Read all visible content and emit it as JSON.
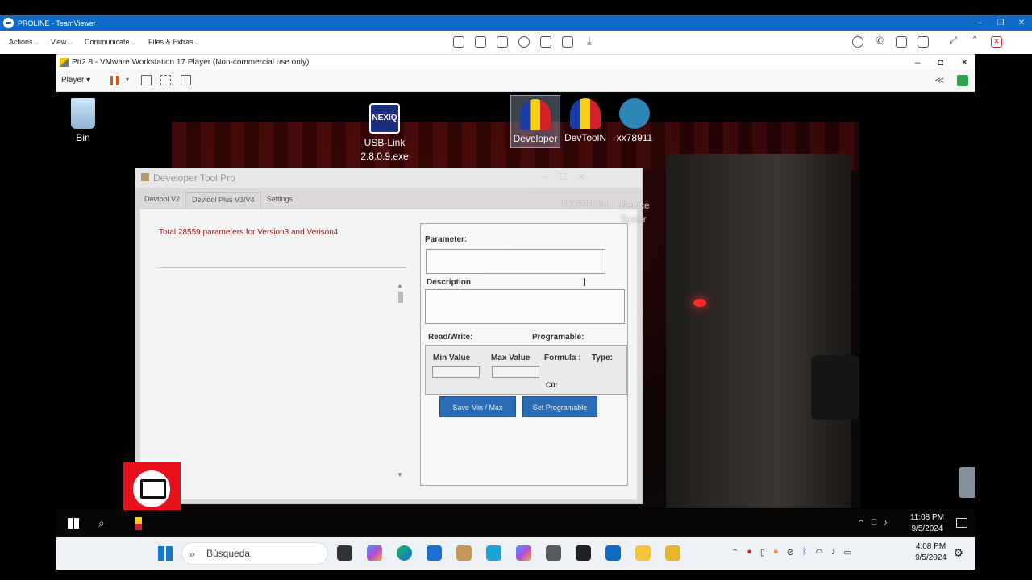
{
  "teamviewer": {
    "title": "PROLINE - TeamViewer",
    "menu": [
      "Actions",
      "View",
      "Communicate",
      "Files & Extras"
    ]
  },
  "vmware": {
    "title": "Ptt2.8 - VMware Workstation 17 Player (Non-commercial use only)",
    "player_label": "Player"
  },
  "desktop": {
    "icons": [
      {
        "label": "Bin",
        "icon": "recycle-bin-icon"
      },
      {
        "label": "USB-Link 2.8.0.9.exe",
        "icon": "nexiq-icon"
      },
      {
        "label": "Developer",
        "icon": "flag-icon"
      },
      {
        "label": "DevToolN",
        "icon": "flag-icon"
      },
      {
        "label": "xx78911",
        "icon": "tool-icon"
      }
    ],
    "ghost_labels": {
      "fixptt": "FIXPTT.bat",
      "device_tester": "Device Tester"
    }
  },
  "devtool": {
    "title": "Developer Tool Pro",
    "tabs": [
      "Devtool V2",
      "Devtool Plus V3/V4",
      "Settings"
    ],
    "active_tab": "Devtool Plus V3/V4",
    "total_text": "Total 28559 parameters for Version3 and Verison4",
    "parameter_label": "Parameter:",
    "parameter_value": "",
    "description_label": "Description",
    "read_write_label": "Read/Write:",
    "programable_label": "Programable:",
    "min_value_label": "Min Value",
    "max_value_label": "Max Value",
    "formula_label": "Formula :",
    "type_label": "Type:",
    "c0_label": "C0:",
    "save_button": "Save Min / Max",
    "set_button": "Set Programable"
  },
  "guest_taskbar": {
    "time": "11:08 PM",
    "date": "9/5/2024"
  },
  "host_taskbar": {
    "search_placeholder": "Búsqueda",
    "time": "4:08 PM",
    "date": "9/5/2024"
  }
}
